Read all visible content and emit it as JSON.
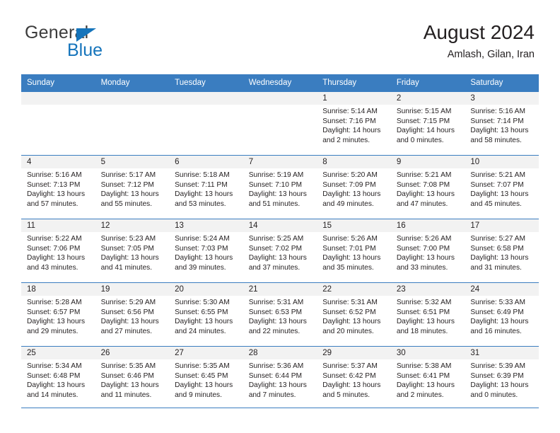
{
  "brand": {
    "line1": "General",
    "line2": "Blue",
    "triangle_icon": "brand-triangle-icon",
    "color_dark": "#3b3b3b",
    "color_blue": "#1574bb"
  },
  "header": {
    "title": "August 2024",
    "subtitle": "Amlash, Gilan, Iran"
  },
  "theme": {
    "header_blue": "#3a7dc0",
    "daynum_band": "#f2f2f2",
    "text": "#231f20"
  },
  "weekdays": [
    "Sunday",
    "Monday",
    "Tuesday",
    "Wednesday",
    "Thursday",
    "Friday",
    "Saturday"
  ],
  "weeks": [
    [
      {
        "day": "",
        "sunrise": "",
        "sunset": "",
        "daylight_line1": "",
        "daylight_line2": ""
      },
      {
        "day": "",
        "sunrise": "",
        "sunset": "",
        "daylight_line1": "",
        "daylight_line2": ""
      },
      {
        "day": "",
        "sunrise": "",
        "sunset": "",
        "daylight_line1": "",
        "daylight_line2": ""
      },
      {
        "day": "",
        "sunrise": "",
        "sunset": "",
        "daylight_line1": "",
        "daylight_line2": ""
      },
      {
        "day": "1",
        "sunrise": "Sunrise: 5:14 AM",
        "sunset": "Sunset: 7:16 PM",
        "daylight_line1": "Daylight: 14 hours",
        "daylight_line2": "and 2 minutes."
      },
      {
        "day": "2",
        "sunrise": "Sunrise: 5:15 AM",
        "sunset": "Sunset: 7:15 PM",
        "daylight_line1": "Daylight: 14 hours",
        "daylight_line2": "and 0 minutes."
      },
      {
        "day": "3",
        "sunrise": "Sunrise: 5:16 AM",
        "sunset": "Sunset: 7:14 PM",
        "daylight_line1": "Daylight: 13 hours",
        "daylight_line2": "and 58 minutes."
      }
    ],
    [
      {
        "day": "4",
        "sunrise": "Sunrise: 5:16 AM",
        "sunset": "Sunset: 7:13 PM",
        "daylight_line1": "Daylight: 13 hours",
        "daylight_line2": "and 57 minutes."
      },
      {
        "day": "5",
        "sunrise": "Sunrise: 5:17 AM",
        "sunset": "Sunset: 7:12 PM",
        "daylight_line1": "Daylight: 13 hours",
        "daylight_line2": "and 55 minutes."
      },
      {
        "day": "6",
        "sunrise": "Sunrise: 5:18 AM",
        "sunset": "Sunset: 7:11 PM",
        "daylight_line1": "Daylight: 13 hours",
        "daylight_line2": "and 53 minutes."
      },
      {
        "day": "7",
        "sunrise": "Sunrise: 5:19 AM",
        "sunset": "Sunset: 7:10 PM",
        "daylight_line1": "Daylight: 13 hours",
        "daylight_line2": "and 51 minutes."
      },
      {
        "day": "8",
        "sunrise": "Sunrise: 5:20 AM",
        "sunset": "Sunset: 7:09 PM",
        "daylight_line1": "Daylight: 13 hours",
        "daylight_line2": "and 49 minutes."
      },
      {
        "day": "9",
        "sunrise": "Sunrise: 5:21 AM",
        "sunset": "Sunset: 7:08 PM",
        "daylight_line1": "Daylight: 13 hours",
        "daylight_line2": "and 47 minutes."
      },
      {
        "day": "10",
        "sunrise": "Sunrise: 5:21 AM",
        "sunset": "Sunset: 7:07 PM",
        "daylight_line1": "Daylight: 13 hours",
        "daylight_line2": "and 45 minutes."
      }
    ],
    [
      {
        "day": "11",
        "sunrise": "Sunrise: 5:22 AM",
        "sunset": "Sunset: 7:06 PM",
        "daylight_line1": "Daylight: 13 hours",
        "daylight_line2": "and 43 minutes."
      },
      {
        "day": "12",
        "sunrise": "Sunrise: 5:23 AM",
        "sunset": "Sunset: 7:05 PM",
        "daylight_line1": "Daylight: 13 hours",
        "daylight_line2": "and 41 minutes."
      },
      {
        "day": "13",
        "sunrise": "Sunrise: 5:24 AM",
        "sunset": "Sunset: 7:03 PM",
        "daylight_line1": "Daylight: 13 hours",
        "daylight_line2": "and 39 minutes."
      },
      {
        "day": "14",
        "sunrise": "Sunrise: 5:25 AM",
        "sunset": "Sunset: 7:02 PM",
        "daylight_line1": "Daylight: 13 hours",
        "daylight_line2": "and 37 minutes."
      },
      {
        "day": "15",
        "sunrise": "Sunrise: 5:26 AM",
        "sunset": "Sunset: 7:01 PM",
        "daylight_line1": "Daylight: 13 hours",
        "daylight_line2": "and 35 minutes."
      },
      {
        "day": "16",
        "sunrise": "Sunrise: 5:26 AM",
        "sunset": "Sunset: 7:00 PM",
        "daylight_line1": "Daylight: 13 hours",
        "daylight_line2": "and 33 minutes."
      },
      {
        "day": "17",
        "sunrise": "Sunrise: 5:27 AM",
        "sunset": "Sunset: 6:58 PM",
        "daylight_line1": "Daylight: 13 hours",
        "daylight_line2": "and 31 minutes."
      }
    ],
    [
      {
        "day": "18",
        "sunrise": "Sunrise: 5:28 AM",
        "sunset": "Sunset: 6:57 PM",
        "daylight_line1": "Daylight: 13 hours",
        "daylight_line2": "and 29 minutes."
      },
      {
        "day": "19",
        "sunrise": "Sunrise: 5:29 AM",
        "sunset": "Sunset: 6:56 PM",
        "daylight_line1": "Daylight: 13 hours",
        "daylight_line2": "and 27 minutes."
      },
      {
        "day": "20",
        "sunrise": "Sunrise: 5:30 AM",
        "sunset": "Sunset: 6:55 PM",
        "daylight_line1": "Daylight: 13 hours",
        "daylight_line2": "and 24 minutes."
      },
      {
        "day": "21",
        "sunrise": "Sunrise: 5:31 AM",
        "sunset": "Sunset: 6:53 PM",
        "daylight_line1": "Daylight: 13 hours",
        "daylight_line2": "and 22 minutes."
      },
      {
        "day": "22",
        "sunrise": "Sunrise: 5:31 AM",
        "sunset": "Sunset: 6:52 PM",
        "daylight_line1": "Daylight: 13 hours",
        "daylight_line2": "and 20 minutes."
      },
      {
        "day": "23",
        "sunrise": "Sunrise: 5:32 AM",
        "sunset": "Sunset: 6:51 PM",
        "daylight_line1": "Daylight: 13 hours",
        "daylight_line2": "and 18 minutes."
      },
      {
        "day": "24",
        "sunrise": "Sunrise: 5:33 AM",
        "sunset": "Sunset: 6:49 PM",
        "daylight_line1": "Daylight: 13 hours",
        "daylight_line2": "and 16 minutes."
      }
    ],
    [
      {
        "day": "25",
        "sunrise": "Sunrise: 5:34 AM",
        "sunset": "Sunset: 6:48 PM",
        "daylight_line1": "Daylight: 13 hours",
        "daylight_line2": "and 14 minutes."
      },
      {
        "day": "26",
        "sunrise": "Sunrise: 5:35 AM",
        "sunset": "Sunset: 6:46 PM",
        "daylight_line1": "Daylight: 13 hours",
        "daylight_line2": "and 11 minutes."
      },
      {
        "day": "27",
        "sunrise": "Sunrise: 5:35 AM",
        "sunset": "Sunset: 6:45 PM",
        "daylight_line1": "Daylight: 13 hours",
        "daylight_line2": "and 9 minutes."
      },
      {
        "day": "28",
        "sunrise": "Sunrise: 5:36 AM",
        "sunset": "Sunset: 6:44 PM",
        "daylight_line1": "Daylight: 13 hours",
        "daylight_line2": "and 7 minutes."
      },
      {
        "day": "29",
        "sunrise": "Sunrise: 5:37 AM",
        "sunset": "Sunset: 6:42 PM",
        "daylight_line1": "Daylight: 13 hours",
        "daylight_line2": "and 5 minutes."
      },
      {
        "day": "30",
        "sunrise": "Sunrise: 5:38 AM",
        "sunset": "Sunset: 6:41 PM",
        "daylight_line1": "Daylight: 13 hours",
        "daylight_line2": "and 2 minutes."
      },
      {
        "day": "31",
        "sunrise": "Sunrise: 5:39 AM",
        "sunset": "Sunset: 6:39 PM",
        "daylight_line1": "Daylight: 13 hours",
        "daylight_line2": "and 0 minutes."
      }
    ]
  ]
}
